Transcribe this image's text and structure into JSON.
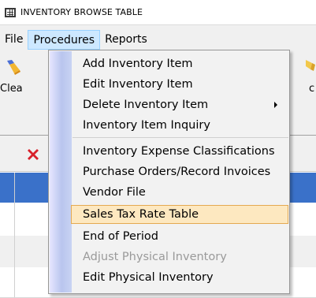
{
  "window": {
    "title": "INVENTORY BROWSE TABLE"
  },
  "menubar": {
    "items": [
      {
        "label": "File"
      },
      {
        "label": "Procedures"
      },
      {
        "label": "Reports"
      }
    ]
  },
  "toolbar": {
    "clear_label": "Clea",
    "right_label": "c"
  },
  "procedures_menu": {
    "items": [
      {
        "label": "Add Inventory Item",
        "enabled": true
      },
      {
        "label": "Edit Inventory Item",
        "enabled": true
      },
      {
        "label": "Delete Inventory Item",
        "enabled": true,
        "submenu": true
      },
      {
        "label": "Inventory Item Inquiry",
        "enabled": true
      },
      {
        "label": "Inventory Expense Classifications",
        "enabled": true
      },
      {
        "label": "Purchase Orders/Record Invoices",
        "enabled": true
      },
      {
        "label": "Vendor File",
        "enabled": true
      },
      {
        "label": "Sales Tax Rate Table",
        "enabled": true,
        "highlighted": true
      },
      {
        "label": "End of Period",
        "enabled": true
      },
      {
        "label": "Adjust Physical Inventory",
        "enabled": false
      },
      {
        "label": "Edit Physical Inventory",
        "enabled": true
      }
    ]
  },
  "colors": {
    "highlight_bg": "#fde8c0",
    "highlight_border": "#e4a951",
    "selected_row": "#3a71c9",
    "menu_active": "#cde8ff"
  }
}
